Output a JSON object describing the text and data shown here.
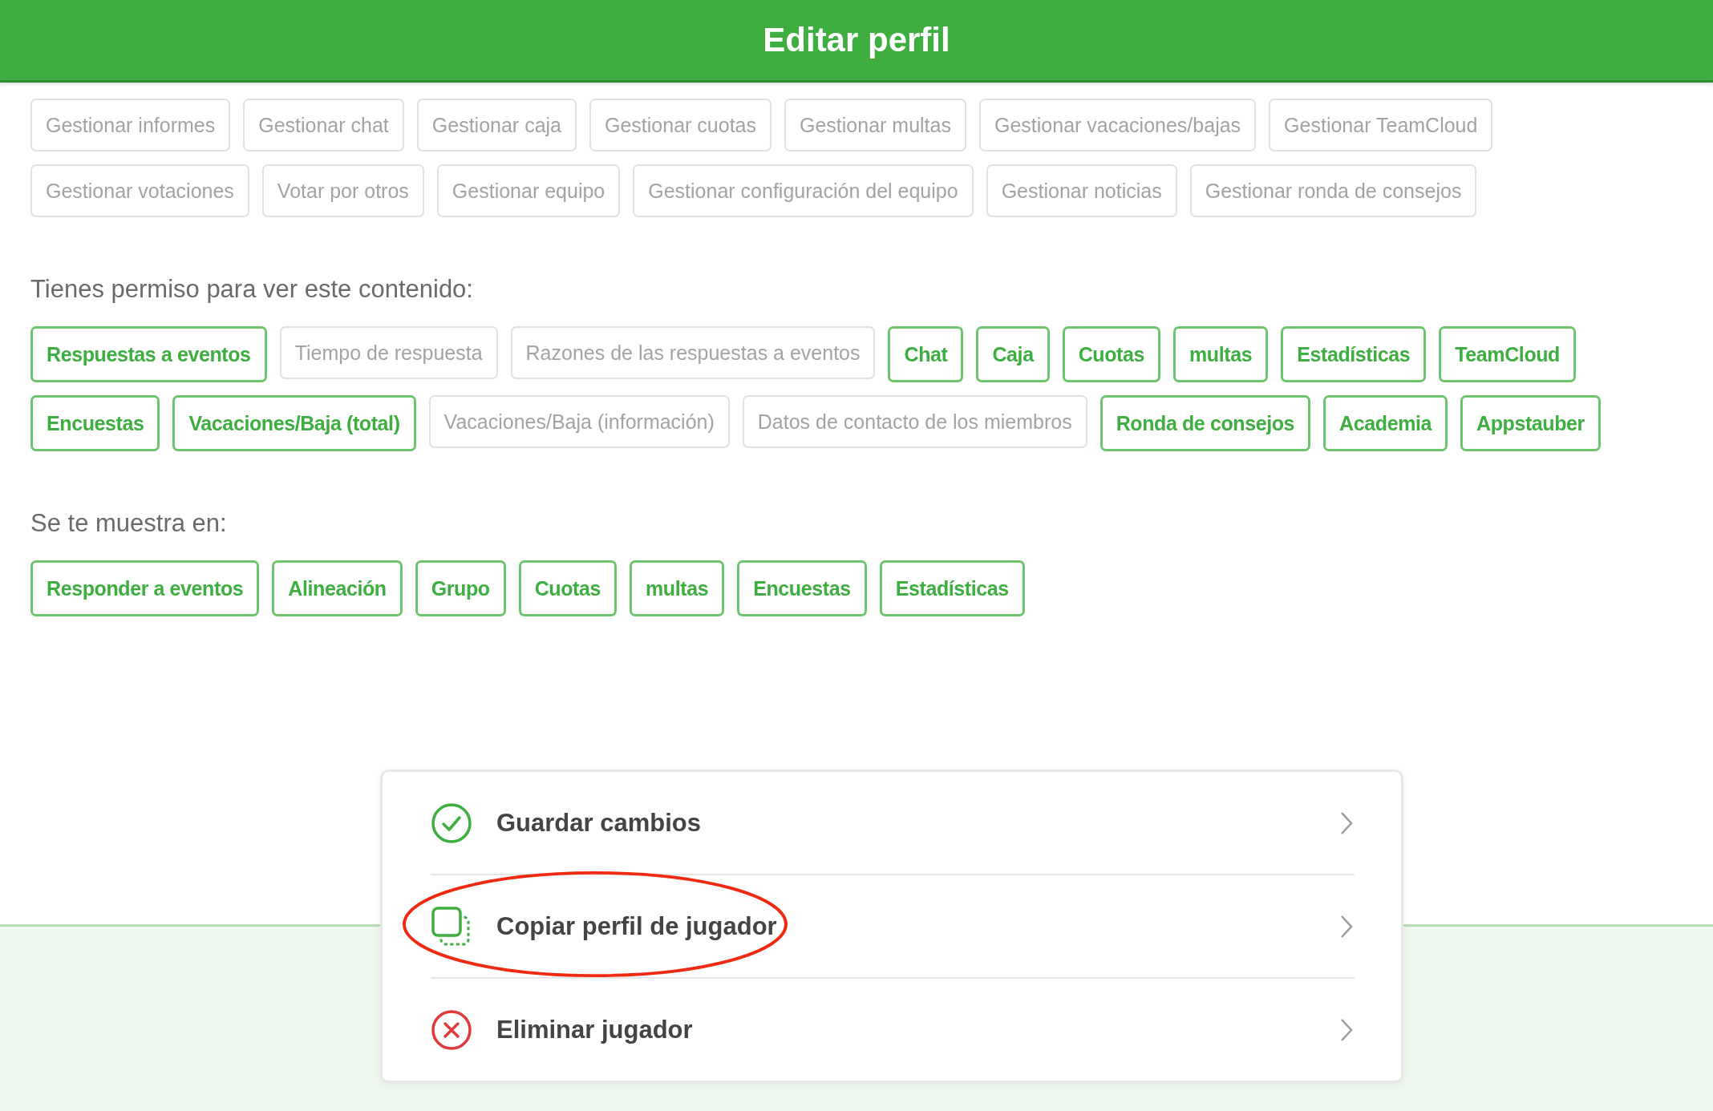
{
  "header": {
    "title": "Editar perfil"
  },
  "manage_tags": [
    {
      "label": "Gestionar informes",
      "selected": false
    },
    {
      "label": "Gestionar chat",
      "selected": false
    },
    {
      "label": "Gestionar caja",
      "selected": false
    },
    {
      "label": "Gestionar cuotas",
      "selected": false
    },
    {
      "label": "Gestionar multas",
      "selected": false
    },
    {
      "label": "Gestionar vacaciones/bajas",
      "selected": false
    },
    {
      "label": "Gestionar TeamCloud",
      "selected": false
    },
    {
      "label": "Gestionar votaciones",
      "selected": false
    },
    {
      "label": "Votar por otros",
      "selected": false
    },
    {
      "label": "Gestionar equipo",
      "selected": false
    },
    {
      "label": "Gestionar configuración del equipo",
      "selected": false
    },
    {
      "label": "Gestionar noticias",
      "selected": false
    },
    {
      "label": "Gestionar ronda de consejos",
      "selected": false
    }
  ],
  "sections": [
    {
      "title": "Tienes permiso para ver este contenido:",
      "tags": [
        {
          "label": "Respuestas a eventos",
          "selected": true
        },
        {
          "label": "Tiempo de respuesta",
          "selected": false
        },
        {
          "label": "Razones de las respuestas a eventos",
          "selected": false
        },
        {
          "label": "Chat",
          "selected": true
        },
        {
          "label": "Caja",
          "selected": true
        },
        {
          "label": "Cuotas",
          "selected": true
        },
        {
          "label": "multas",
          "selected": true
        },
        {
          "label": "Estadísticas",
          "selected": true
        },
        {
          "label": "TeamCloud",
          "selected": true
        },
        {
          "label": "Encuestas",
          "selected": true
        },
        {
          "label": "Vacaciones/Baja (total)",
          "selected": true
        },
        {
          "label": "Vacaciones/Baja (información)",
          "selected": false
        },
        {
          "label": "Datos de contacto de los miembros",
          "selected": false
        },
        {
          "label": "Ronda de consejos",
          "selected": true
        },
        {
          "label": "Academia",
          "selected": true
        },
        {
          "label": "Appstauber",
          "selected": true
        }
      ]
    },
    {
      "title": "Se te muestra en:",
      "tags": [
        {
          "label": "Responder a eventos",
          "selected": true
        },
        {
          "label": "Alineación",
          "selected": true
        },
        {
          "label": "Grupo",
          "selected": true
        },
        {
          "label": "Cuotas",
          "selected": true
        },
        {
          "label": "multas",
          "selected": true
        },
        {
          "label": "Encuestas",
          "selected": true
        },
        {
          "label": "Estadísticas",
          "selected": true
        }
      ]
    }
  ],
  "action_menu": [
    {
      "label": "Guardar cambios",
      "kind": "save",
      "highlighted": false
    },
    {
      "label": "Copiar perfil de jugador",
      "kind": "copy",
      "highlighted": true
    },
    {
      "label": "Eliminar jugador",
      "kind": "delete",
      "highlighted": false
    }
  ]
}
